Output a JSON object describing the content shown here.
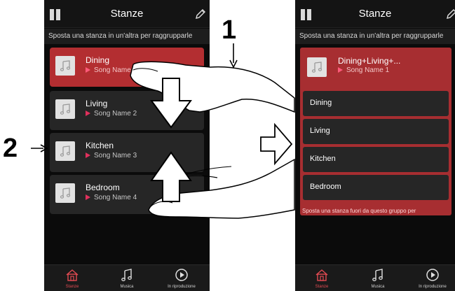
{
  "left_screen": {
    "title": "Stanze",
    "hint": "Sposta una stanza in un'altra per raggrupparle",
    "rooms": [
      {
        "name": "Dining",
        "song": "Song Name 1"
      },
      {
        "name": "Living",
        "song": "Song Name 2"
      },
      {
        "name": "Kitchen",
        "song": "Song Name 3"
      },
      {
        "name": "Bedroom",
        "song": "Song Name 4"
      }
    ],
    "nav": [
      {
        "label": "Stanze",
        "icon": "house-icon"
      },
      {
        "label": "Musica",
        "icon": "music-note-icon"
      },
      {
        "label": "In riproduzione",
        "icon": "play-circle-icon"
      }
    ]
  },
  "right_screen": {
    "title": "Stanze",
    "hint": "Sposta una stanza in un'altra per raggrupparle",
    "group": {
      "name": "Dining+Living+...",
      "song": "Song Name 1",
      "rooms": [
        "Dining",
        "Living",
        "Kitchen",
        "Bedroom"
      ],
      "hint": "Sposta una stanza fuori da questo gruppo per"
    },
    "nav": [
      {
        "label": "Stanze",
        "icon": "house-icon"
      },
      {
        "label": "Musica",
        "icon": "music-note-icon"
      },
      {
        "label": "In riproduzione",
        "icon": "play-circle-icon"
      }
    ]
  },
  "callouts": {
    "one": "1",
    "two": "2"
  },
  "colors": {
    "selected_room": "#b32e31",
    "accent_pink": "#e0305c",
    "active_nav": "#e34a52"
  }
}
